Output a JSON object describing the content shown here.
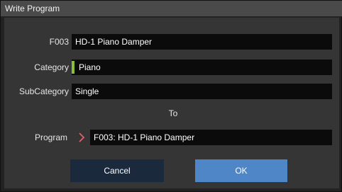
{
  "dialog": {
    "title": "Write Program"
  },
  "fields": {
    "number_label": "F003",
    "number_value": "HD-1 Piano Damper",
    "category_label": "Category",
    "category_value": "Piano",
    "category_color": "#8bbf3a",
    "subcategory_label": "SubCategory",
    "subcategory_value": "Single"
  },
  "to_label": "To",
  "program": {
    "label": "Program",
    "value": "F003: HD-1 Piano Damper",
    "arrow_icon": "chevron-right-icon",
    "arrow_color": "#e0606a"
  },
  "buttons": {
    "cancel_label": "Cancel",
    "ok_label": "OK"
  }
}
